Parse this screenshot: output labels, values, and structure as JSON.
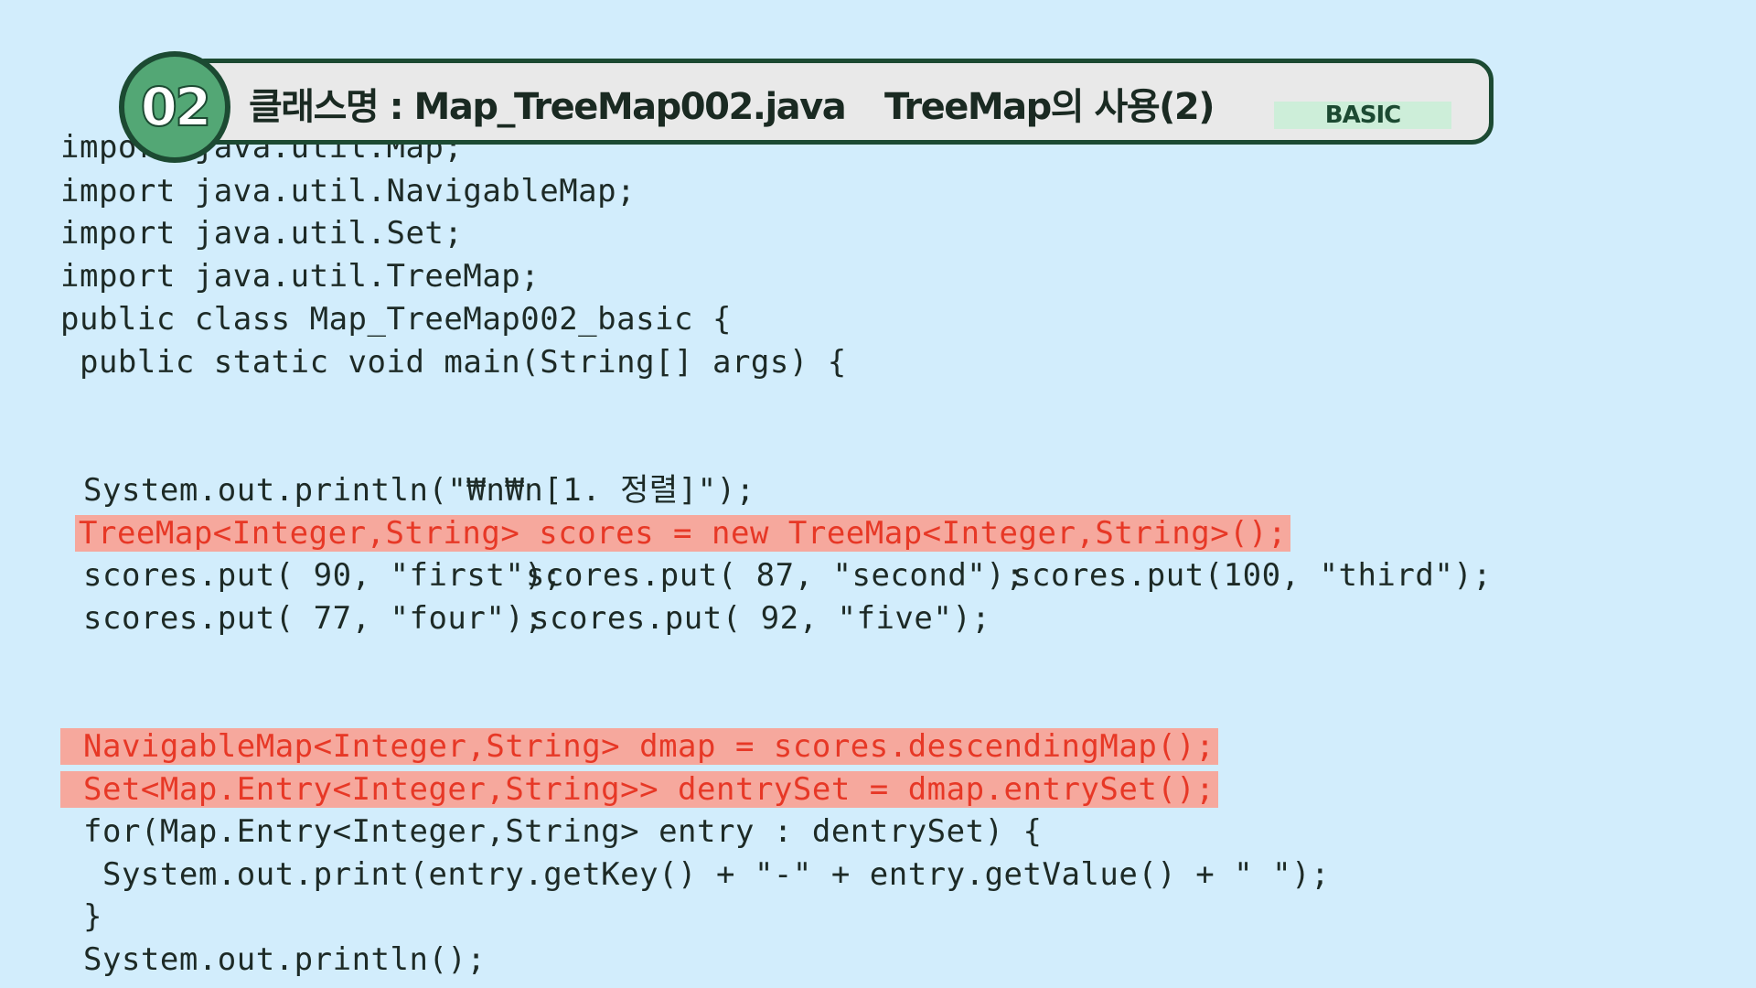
{
  "header": {
    "number": "02",
    "class_name": "클래스명 : Map_TreeMap002.java",
    "topic": "TreeMap의 사용(2)",
    "level": "BASIC"
  },
  "code": {
    "line_cut": "import java.util.Map;",
    "line_01": "import java.util.NavigableMap;",
    "line_02": "import java.util.Set;",
    "line_03": "import java.util.TreeMap;",
    "line_04": "public class Map_TreeMap002_basic {",
    "line_05": " public static void main(String[] args) {",
    "line_06": "System.out.println(\"₩n₩n[1. 정렬]\");",
    "line_07": "TreeMap<Integer,String> scores = new TreeMap<Integer,String>();",
    "line_08a": "scores.put( 90, \"first\");",
    "line_08b": "scores.put( 87, \"second\");",
    "line_08c": "scores.put(100, \"third\");",
    "line_09a": "scores.put( 77, \"four\");",
    "line_09b": "scores.put( 92, \"five\");",
    "line_10": "NavigableMap<Integer,String> dmap = scores.descendingMap();",
    "line_11": "Set<Map.Entry<Integer,String>> dentrySet = dmap.entrySet();",
    "line_12": "for(Map.Entry<Integer,String> entry : dentrySet) {",
    "line_13": " System.out.print(entry.getKey() + \"-\" + entry.getValue() + \" \");",
    "line_14": "}",
    "line_15": "System.out.println();"
  },
  "colors": {
    "background": "#d2edfc",
    "highlight_bg": "#f6a89d",
    "highlight_text": "#e73826",
    "accent_green": "#53a775",
    "dark_green": "#1c4a32"
  }
}
